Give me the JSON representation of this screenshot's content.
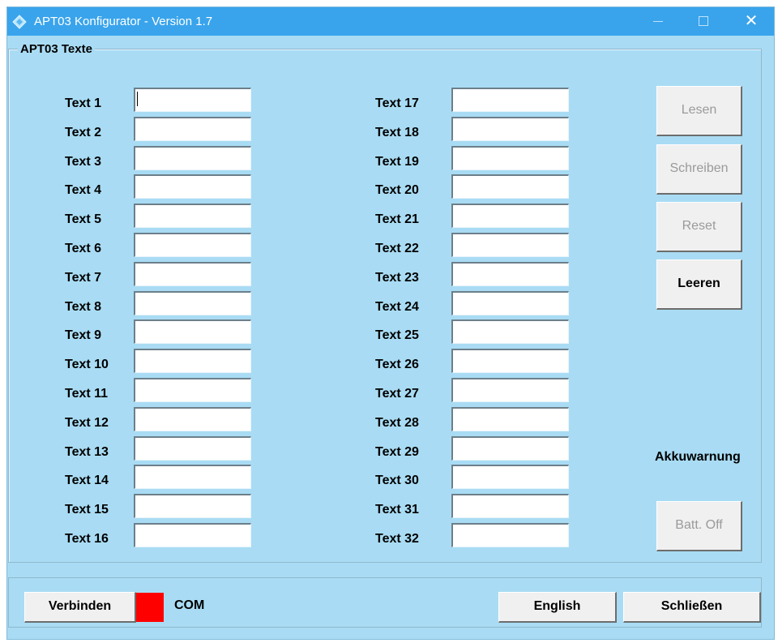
{
  "window": {
    "title": "APT03 Konfigurator - Version 1.7"
  },
  "group": {
    "title": "APT03 Texte",
    "left_column": [
      {
        "label": "Text 1",
        "value": ""
      },
      {
        "label": "Text 2",
        "value": ""
      },
      {
        "label": "Text 3",
        "value": ""
      },
      {
        "label": "Text 4",
        "value": ""
      },
      {
        "label": "Text 5",
        "value": ""
      },
      {
        "label": "Text 6",
        "value": ""
      },
      {
        "label": "Text 7",
        "value": ""
      },
      {
        "label": "Text 8",
        "value": ""
      },
      {
        "label": "Text 9",
        "value": ""
      },
      {
        "label": "Text 10",
        "value": ""
      },
      {
        "label": "Text 11",
        "value": ""
      },
      {
        "label": "Text 12",
        "value": ""
      },
      {
        "label": "Text 13",
        "value": ""
      },
      {
        "label": "Text 14",
        "value": ""
      },
      {
        "label": "Text 15",
        "value": ""
      },
      {
        "label": "Text 16",
        "value": ""
      }
    ],
    "right_column": [
      {
        "label": "Text 17",
        "value": ""
      },
      {
        "label": "Text 18",
        "value": ""
      },
      {
        "label": "Text 19",
        "value": ""
      },
      {
        "label": "Text 20",
        "value": ""
      },
      {
        "label": "Text 21",
        "value": ""
      },
      {
        "label": "Text 22",
        "value": ""
      },
      {
        "label": "Text 23",
        "value": ""
      },
      {
        "label": "Text 24",
        "value": ""
      },
      {
        "label": "Text 25",
        "value": ""
      },
      {
        "label": "Text 26",
        "value": ""
      },
      {
        "label": "Text 27",
        "value": ""
      },
      {
        "label": "Text 28",
        "value": ""
      },
      {
        "label": "Text 29",
        "value": ""
      },
      {
        "label": "Text 30",
        "value": ""
      },
      {
        "label": "Text 31",
        "value": ""
      },
      {
        "label": "Text 32",
        "value": ""
      }
    ]
  },
  "actions": {
    "lesen": "Lesen",
    "schreiben": "Schreiben",
    "reset": "Reset",
    "leeren": "Leeren",
    "akkuwarnung_label": "Akkuwarnung",
    "batt_off": "Batt. Off"
  },
  "footer": {
    "connect": "Verbinden",
    "com_label": "COM",
    "language": "English",
    "close": "Schließen"
  },
  "colors": {
    "window_bg": "#a9dcf4",
    "titlebar": "#39a4ec",
    "status_disconnected": "#ff0000"
  },
  "icons": {
    "app": "app-diamond-icon",
    "minimize": "minimize-icon",
    "maximize": "maximize-icon",
    "close": "close-icon"
  }
}
